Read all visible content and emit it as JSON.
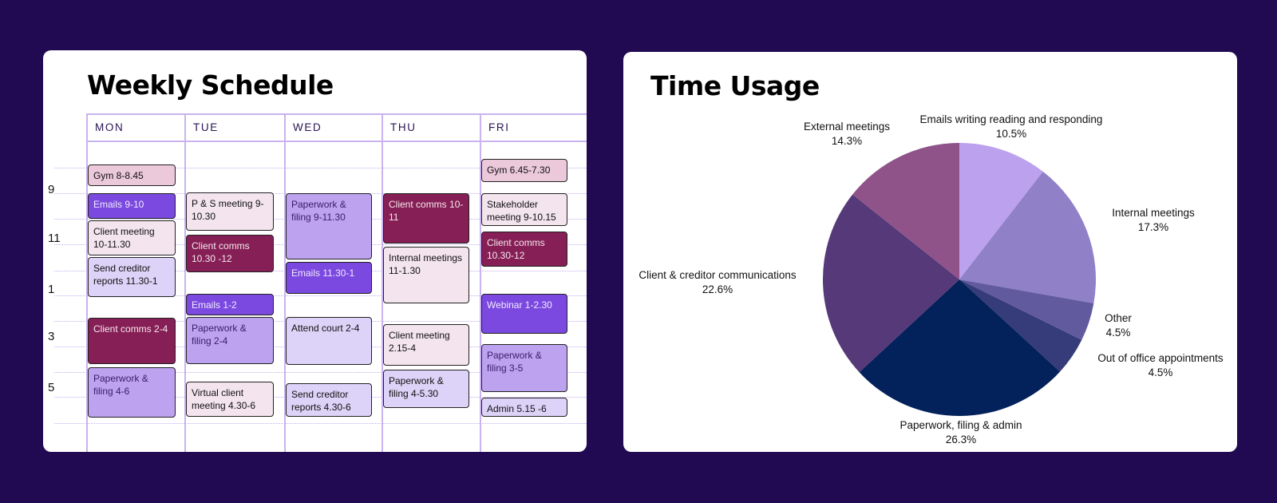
{
  "schedule": {
    "title": "Weekly Schedule",
    "days": [
      "MON",
      "TUE",
      "WED",
      "THU",
      "FRI"
    ],
    "hour_labels": [
      "9",
      "11",
      "1",
      "3",
      "5"
    ],
    "events": [
      {
        "day": 0,
        "label": "Gym 8-8.45",
        "style": "pink"
      },
      {
        "day": 0,
        "label": "Emails 9-10",
        "style": "purple"
      },
      {
        "day": 0,
        "label": "Client meeting 10-11.30",
        "style": "light"
      },
      {
        "day": 0,
        "label": "Send creditor reports 11.30-1",
        "style": "lav"
      },
      {
        "day": 0,
        "label": "Client comms 2-4",
        "style": "maroon"
      },
      {
        "day": 0,
        "label": "Paperwork & filing 4-6",
        "style": "mid"
      },
      {
        "day": 1,
        "label": "P & S meeting 9-10.30",
        "style": "light"
      },
      {
        "day": 1,
        "label": "Client comms 10.30 -12",
        "style": "maroon"
      },
      {
        "day": 1,
        "label": "Emails 1-2",
        "style": "purple"
      },
      {
        "day": 1,
        "label": "Paperwork & filing 2-4",
        "style": "mid"
      },
      {
        "day": 1,
        "label": "Virtual client meeting 4.30-6",
        "style": "light"
      },
      {
        "day": 2,
        "label": "Paperwork & filing 9-11.30",
        "style": "mid"
      },
      {
        "day": 2,
        "label": "Emails 11.30-1",
        "style": "purple"
      },
      {
        "day": 2,
        "label": "Attend court 2-4",
        "style": "lav"
      },
      {
        "day": 2,
        "label": "Send creditor reports 4.30-6",
        "style": "lav"
      },
      {
        "day": 3,
        "label": "Client comms 10-11",
        "style": "maroon"
      },
      {
        "day": 3,
        "label": "Internal meetings 11-1.30",
        "style": "light"
      },
      {
        "day": 3,
        "label": "Client meeting 2.15-4",
        "style": "light"
      },
      {
        "day": 3,
        "label": "Paperwork & filing 4-5.30",
        "style": "lav"
      },
      {
        "day": 4,
        "label": "Gym 6.45-7.30",
        "style": "pink"
      },
      {
        "day": 4,
        "label": "Stakeholder meeting 9-10.15",
        "style": "light"
      },
      {
        "day": 4,
        "label": "Client comms 10.30-12",
        "style": "maroon"
      },
      {
        "day": 4,
        "label": "Webinar 1-2.30",
        "style": "purple"
      },
      {
        "day": 4,
        "label": "Paperwork & filing 3-5",
        "style": "mid"
      },
      {
        "day": 4,
        "label": "Admin 5.15 -6",
        "style": "lav"
      }
    ]
  },
  "chart_data": {
    "type": "pie",
    "title": "Time Usage",
    "start": "top, clockwise",
    "slices": [
      {
        "label": "Emails writing reading and responding",
        "value": 10.5,
        "display": "10.5%",
        "color": "#bca1ee"
      },
      {
        "label": "Internal meetings",
        "value": 17.3,
        "display": "17.3%",
        "color": "#8f80c8"
      },
      {
        "label": "Other",
        "value": 4.5,
        "display": "4.5%",
        "color": "#625a9f"
      },
      {
        "label": "Out of office appointments",
        "value": 4.5,
        "display": "4.5%",
        "color": "#363c7a"
      },
      {
        "label": "Paperwork, filing & admin",
        "value": 26.3,
        "display": "26.3%",
        "color": "#03215a"
      },
      {
        "label": "Client & creditor communications",
        "value": 22.6,
        "display": "22.6%",
        "color": "#553978"
      },
      {
        "label": "External meetings",
        "value": 14.3,
        "display": "14.3%",
        "color": "#8f538a"
      }
    ]
  }
}
